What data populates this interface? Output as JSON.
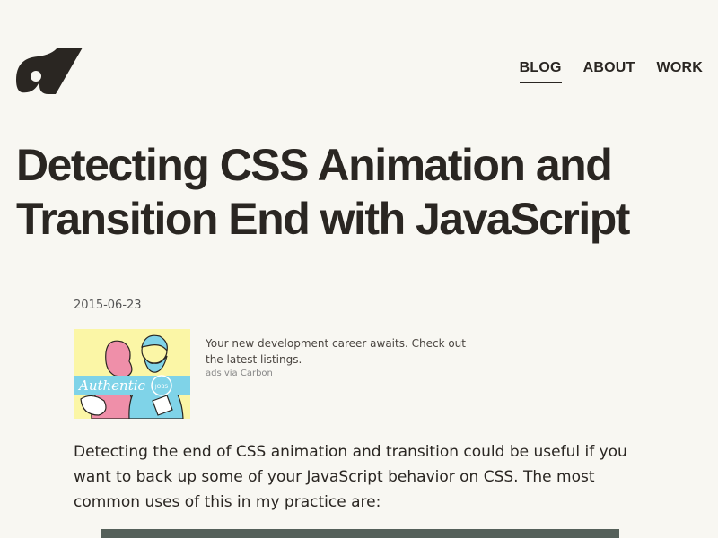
{
  "nav": {
    "blog": "BLOG",
    "about": "ABOUT",
    "work": "WORK"
  },
  "post": {
    "title": "Detecting CSS Animation and Transition End with JavaScript",
    "date": "2015-06-23",
    "intro": "Detecting the end of CSS animation and transition could be useful if you want to back up some of your JavaScript behavior on CSS. The most common uses of this in my practice are:"
  },
  "ad": {
    "image_text": "Authentic",
    "badge": "JOBS",
    "text": "Your new development career awaits. Check out the latest listings.",
    "via": "ads via Carbon"
  },
  "colors": {
    "background": "#f8f7f2",
    "text": "#2a2622",
    "ad_yellow": "#fbf6a6",
    "ad_cyan": "#7fd3e8",
    "ad_pink": "#ef8fa9"
  },
  "icons": [
    "site-logo-icon"
  ]
}
